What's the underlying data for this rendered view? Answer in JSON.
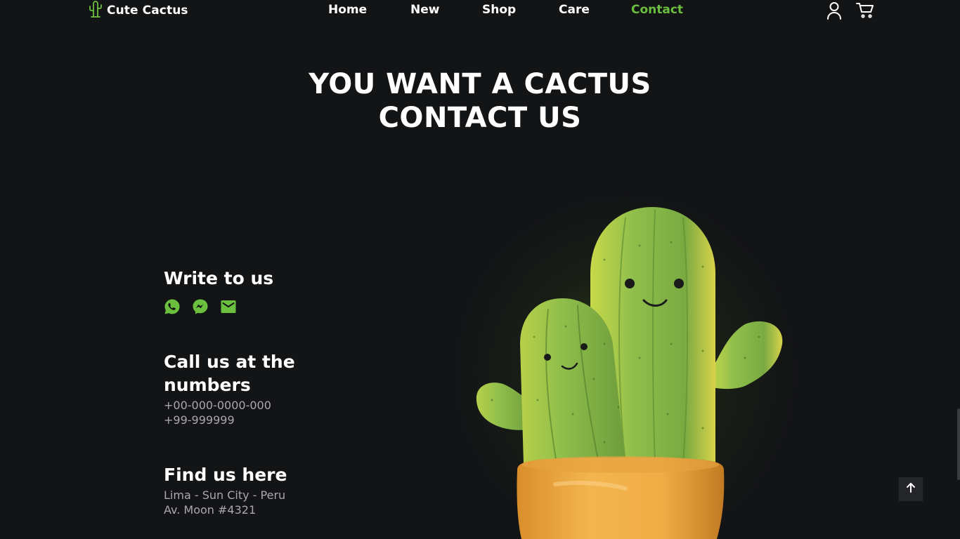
{
  "brand": {
    "name": "Cute Cactus",
    "accent": "#6bbf3f"
  },
  "nav": {
    "items": [
      {
        "label": "Home"
      },
      {
        "label": "New"
      },
      {
        "label": "Shop"
      },
      {
        "label": "Care"
      },
      {
        "label": "Contact",
        "active": true
      }
    ]
  },
  "header_icons": [
    "user-icon",
    "cart-icon"
  ],
  "hero": {
    "line1": "YOU WANT A CACTUS",
    "line2": "CONTACT US"
  },
  "contact": {
    "write": {
      "title": "Write to us",
      "icons": [
        "whatsapp-icon",
        "messenger-icon",
        "mail-icon"
      ]
    },
    "call": {
      "title": "Call us at the numbers",
      "phone1": "+00-000-0000-000",
      "phone2": "+99-999999"
    },
    "find": {
      "title": "Find us here",
      "line1": "Lima - Sun City - Peru",
      "line2": "Av. Moon #4321"
    }
  },
  "scroll_button": {
    "icon": "arrow-up-icon"
  }
}
